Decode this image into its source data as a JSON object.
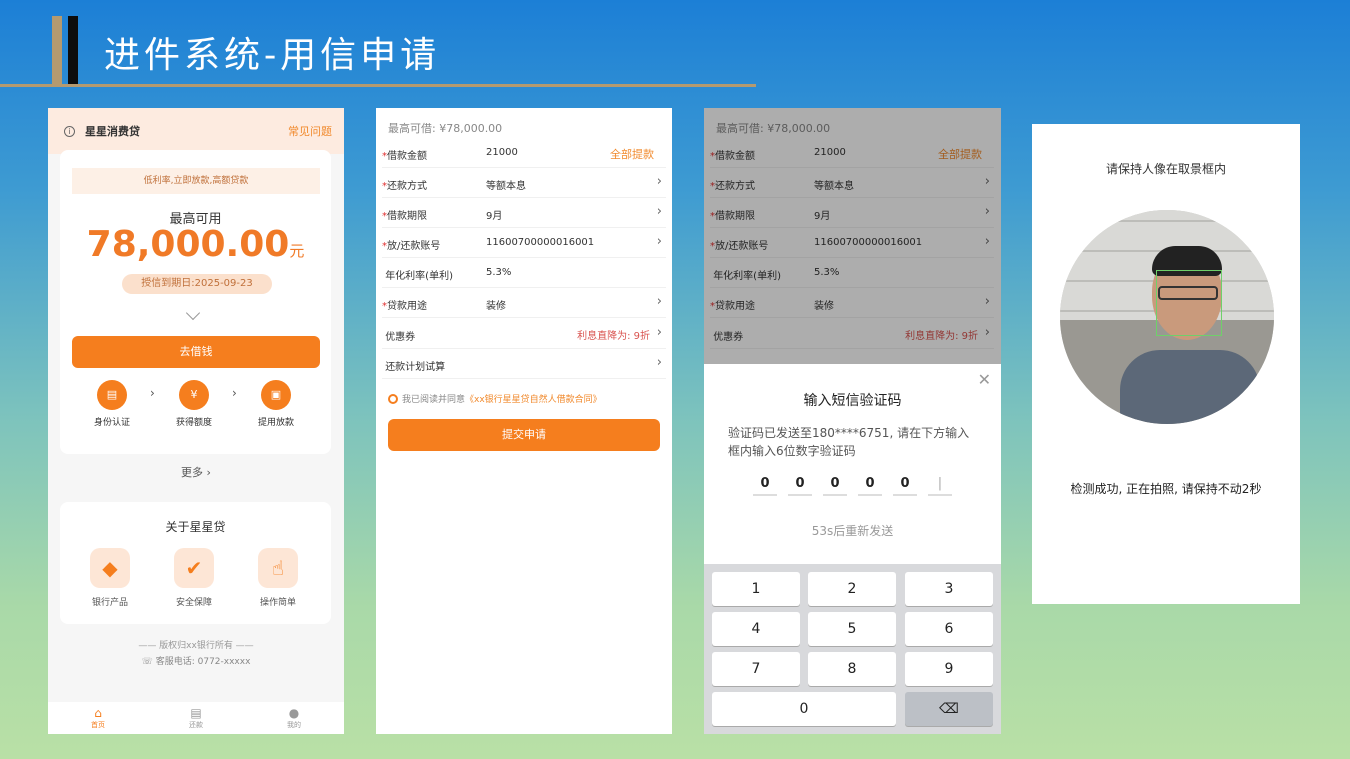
{
  "slide": {
    "title": "进件系统-用信申请"
  },
  "home": {
    "brand": "星星消费贷",
    "faq": "常见问题",
    "tagline": "低利率,立即放款,高额贷款",
    "max_label": "最高可用",
    "amount": "78,000.00",
    "unit": "元",
    "expire": "授信到期日:2025-09-23",
    "borrow_button": "去借钱",
    "steps": [
      "身份认证",
      "获得额度",
      "提用放款"
    ],
    "more": "更多",
    "about_title": "关于星星贷",
    "features": [
      "银行产品",
      "安全保障",
      "操作简单"
    ],
    "copyright": "—— 版权归xx银行所有 ——",
    "service": "客服电话: 0772-xxxxx",
    "tabs": [
      "首页",
      "还款",
      "我的"
    ]
  },
  "form": {
    "max_line": "最高可借: ¥78,000.00",
    "rows": [
      {
        "label": "借款金额",
        "required": "*",
        "value": "21000",
        "extra": "全部提款"
      },
      {
        "label": "还款方式",
        "required": "*",
        "value": "等额本息"
      },
      {
        "label": "借款期限",
        "required": "*",
        "value": "9月"
      },
      {
        "label": "放/还款账号",
        "required": "*",
        "value": "11600700000016001"
      },
      {
        "label": "年化利率(单利)",
        "required": "",
        "value": "5.3%"
      },
      {
        "label": "贷款用途",
        "required": "*",
        "value": "装修"
      },
      {
        "label": "优惠券",
        "required": "",
        "value": "",
        "extra": "利息直降为: 9折"
      },
      {
        "label": "还款计划试算",
        "required": "",
        "value": ""
      }
    ],
    "agree_text": "我已阅读并同意",
    "agree_link": "《xx银行星星贷自然人借款合同》",
    "submit": "提交申请"
  },
  "sms": {
    "title": "输入短信验证码",
    "desc": "验证码已发送至180****6751, 请在下方输入框内输入6位数字验证码",
    "digits": [
      "0",
      "0",
      "0",
      "0",
      "0",
      "|"
    ],
    "resend": "53s后重新发送",
    "keys": [
      "1",
      "2",
      "3",
      "4",
      "5",
      "6",
      "7",
      "8",
      "9",
      "0"
    ]
  },
  "face": {
    "title": "请保持人像在取景框内",
    "status": "检测成功, 正在拍照, 请保持不动2秒"
  }
}
